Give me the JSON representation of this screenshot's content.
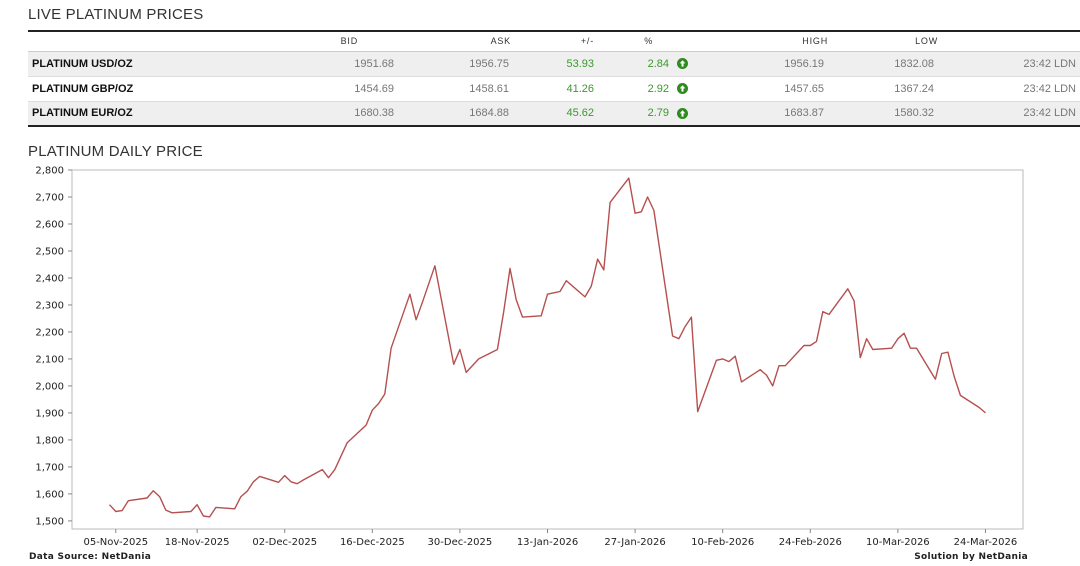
{
  "live": {
    "title": "LIVE PLATINUM PRICES",
    "columns": [
      "",
      "BID",
      "ASK",
      "+/-",
      "%",
      "",
      "HIGH",
      "LOW",
      ""
    ],
    "rows": [
      {
        "name": "PLATINUM USD/OZ",
        "bid": "1951.68",
        "ask": "1956.75",
        "change": "53.93",
        "pct": "2.84",
        "direction": "up-arrow-icon",
        "high": "1956.19",
        "low": "1832.08",
        "time": "23:42 LDN"
      },
      {
        "name": "PLATINUM GBP/OZ",
        "bid": "1454.69",
        "ask": "1458.61",
        "change": "41.26",
        "pct": "2.92",
        "direction": "up-arrow-icon",
        "high": "1457.65",
        "low": "1367.24",
        "time": "23:42 LDN"
      },
      {
        "name": "PLATINUM EUR/OZ",
        "bid": "1680.38",
        "ask": "1684.88",
        "change": "45.62",
        "pct": "2.79",
        "direction": "up-arrow-icon",
        "high": "1683.87",
        "low": "1580.32",
        "time": "23:42 LDN"
      }
    ],
    "colors": {
      "positive": "#3a9a2a",
      "up_icon": "#2f8a1f"
    }
  },
  "daily": {
    "title": "PLATINUM DAILY PRICE",
    "source": "Data Source: NetDania",
    "solution": "Solution by NetDania"
  },
  "chart_data": {
    "type": "line",
    "title": "",
    "xlabel": "",
    "ylabel": "",
    "ylim": [
      1470,
      2800
    ],
    "yticks": [
      "1,500",
      "1,600",
      "1,700",
      "1,800",
      "1,900",
      "2,000",
      "2,100",
      "2,200",
      "2,300",
      "2,400",
      "2,500",
      "2,600",
      "2,700",
      "2,800"
    ],
    "xticks": [
      "05-Nov-2025",
      "18-Nov-2025",
      "02-Dec-2025",
      "16-Dec-2025",
      "30-Dec-2025",
      "13-Jan-2026",
      "27-Jan-2026",
      "10-Feb-2026",
      "24-Feb-2026",
      "10-Mar-2026",
      "24-Mar-2026"
    ],
    "grid": false,
    "line_color": "#b5504f",
    "x": [
      "2025-11-04",
      "2025-11-05",
      "2025-11-06",
      "2025-11-07",
      "2025-11-10",
      "2025-11-11",
      "2025-11-12",
      "2025-11-13",
      "2025-11-14",
      "2025-11-17",
      "2025-11-18",
      "2025-11-19",
      "2025-11-20",
      "2025-11-21",
      "2025-11-24",
      "2025-11-25",
      "2025-11-26",
      "2025-11-27",
      "2025-11-28",
      "2025-12-01",
      "2025-12-02",
      "2025-12-03",
      "2025-12-04",
      "2025-12-05",
      "2025-12-08",
      "2025-12-09",
      "2025-12-10",
      "2025-12-11",
      "2025-12-12",
      "2025-12-15",
      "2025-12-16",
      "2025-12-17",
      "2025-12-18",
      "2025-12-19",
      "2025-12-22",
      "2025-12-23",
      "2025-12-24",
      "2025-12-26",
      "2025-12-29",
      "2025-12-30",
      "2025-12-31",
      "2026-01-02",
      "2026-01-05",
      "2026-01-06",
      "2026-01-07",
      "2026-01-08",
      "2026-01-09",
      "2026-01-12",
      "2026-01-13",
      "2026-01-14",
      "2026-01-15",
      "2026-01-16",
      "2026-01-19",
      "2026-01-20",
      "2026-01-21",
      "2026-01-22",
      "2026-01-23",
      "2026-01-26",
      "2026-01-27",
      "2026-01-28",
      "2026-01-29",
      "2026-01-30",
      "2026-02-02",
      "2026-02-03",
      "2026-02-04",
      "2026-02-05",
      "2026-02-06",
      "2026-02-09",
      "2026-02-10",
      "2026-02-11",
      "2026-02-12",
      "2026-02-13",
      "2026-02-16",
      "2026-02-17",
      "2026-02-18",
      "2026-02-19",
      "2026-02-20",
      "2026-02-23",
      "2026-02-24",
      "2026-02-25",
      "2026-02-26",
      "2026-02-27",
      "2026-03-02",
      "2026-03-03",
      "2026-03-04",
      "2026-03-05",
      "2026-03-06",
      "2026-03-09",
      "2026-03-10",
      "2026-03-11",
      "2026-03-12",
      "2026-03-13",
      "2026-03-16",
      "2026-03-17",
      "2026-03-18",
      "2026-03-19",
      "2026-03-20",
      "2026-03-23",
      "2026-03-24"
    ],
    "series": [
      {
        "values": [
          1560,
          1535,
          1538,
          1575,
          1585,
          1612,
          1590,
          1540,
          1530,
          1535,
          1560,
          1518,
          1515,
          1550,
          1545,
          1590,
          1610,
          1645,
          1665,
          1643,
          1668,
          1645,
          1638,
          1652,
          1690,
          1660,
          1690,
          1740,
          1790,
          1855,
          1910,
          1935,
          1970,
          2140,
          2340,
          2245,
          2310,
          2445,
          2080,
          2135,
          2050,
          2100,
          2135,
          2275,
          2435,
          2320,
          2255,
          2260,
          2340,
          2345,
          2350,
          2390,
          2330,
          2370,
          2470,
          2430,
          2680,
          2770,
          2640,
          2645,
          2700,
          2650,
          2185,
          2175,
          2220,
          2255,
          1905,
          2095,
          2100,
          2090,
          2110,
          2015,
          2060,
          2040,
          2000,
          2075,
          2075,
          2150,
          2150,
          2165,
          2275,
          2265,
          2360,
          2315,
          2105,
          2175,
          2135,
          2140,
          2175,
          2195,
          2140,
          2140,
          2025,
          2120,
          2125,
          2035,
          1965,
          1920,
          1900,
          1950
        ]
      }
    ]
  }
}
